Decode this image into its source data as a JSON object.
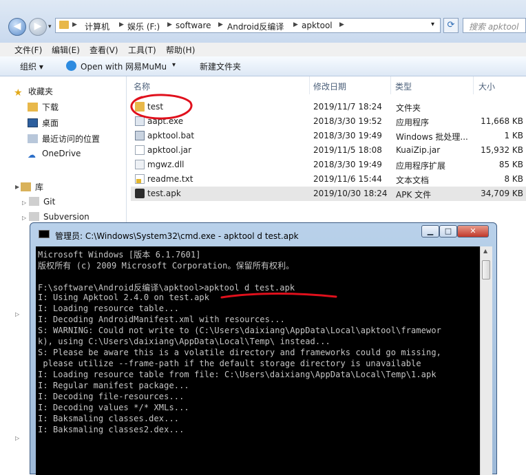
{
  "address": {
    "crumbs": [
      "计算机",
      "娱乐 (F:)",
      "software",
      "Android反编译",
      "apktool"
    ],
    "search_placeholder": "搜索 apktool"
  },
  "menu": [
    "文件(F)",
    "编辑(E)",
    "查看(V)",
    "工具(T)",
    "帮助(H)"
  ],
  "toolbar": {
    "organize": "组织 ▾",
    "open_with": "Open with 网易MuMu",
    "new_folder": "新建文件夹"
  },
  "nav": {
    "favorites": "收藏夹",
    "downloads": "下载",
    "desktop": "桌面",
    "recent": "最近访问的位置",
    "onedrive": "OneDrive",
    "libraries": "库",
    "git": "Git",
    "subversion": "Subversion"
  },
  "columns": {
    "name": "名称",
    "modified": "修改日期",
    "type": "类型",
    "size": "大小"
  },
  "files": [
    {
      "name": "test",
      "date": "2019/11/7 18:24",
      "type": "文件夹",
      "size": "",
      "icon": "folder-icon"
    },
    {
      "name": "aapt.exe",
      "date": "2018/3/30 19:52",
      "type": "应用程序",
      "size": "11,668 KB",
      "icon": "exe-icon"
    },
    {
      "name": "apktool.bat",
      "date": "2018/3/30 19:49",
      "type": "Windows 批处理...",
      "size": "1 KB",
      "icon": "bat-icon"
    },
    {
      "name": "apktool.jar",
      "date": "2019/11/5 18:08",
      "type": "KuaiZip.jar",
      "size": "15,932 KB",
      "icon": "file-icon"
    },
    {
      "name": "mgwz.dll",
      "date": "2018/3/30 19:49",
      "type": "应用程序扩展",
      "size": "85 KB",
      "icon": "dll-icon"
    },
    {
      "name": "readme.txt",
      "date": "2019/11/6 15:44",
      "type": "文本文档",
      "size": "8 KB",
      "icon": "txt-icon"
    },
    {
      "name": "test.apk",
      "date": "2019/10/30 18:24",
      "type": "APK 文件",
      "size": "34,709 KB",
      "icon": "apk-icon"
    }
  ],
  "cmd": {
    "title": "管理员: C:\\Windows\\System32\\cmd.exe - apktool  d test.apk",
    "lines": [
      "Microsoft Windows [版本 6.1.7601]",
      "版权所有 (c) 2009 Microsoft Corporation。保留所有权利。",
      "",
      "F:\\software\\Android反编译\\apktool>apktool d test.apk",
      "I: Using Apktool 2.4.0 on test.apk",
      "I: Loading resource table...",
      "I: Decoding AndroidManifest.xml with resources...",
      "S: WARNING: Could not write to (C:\\Users\\daixiang\\AppData\\Local\\apktool\\framewor",
      "k), using C:\\Users\\daixiang\\AppData\\Local\\Temp\\ instead...",
      "S: Please be aware this is a volatile directory and frameworks could go missing,",
      " please utilize --frame-path if the default storage directory is unavailable",
      "I: Loading resource table from file: C:\\Users\\daixiang\\AppData\\Local\\Temp\\1.apk",
      "I: Regular manifest package...",
      "I: Decoding file-resources...",
      "I: Decoding values */* XMLs...",
      "I: Baksmaling classes.dex...",
      "I: Baksmaling classes2.dex..."
    ]
  },
  "colors": {
    "annotation": "#e0101c",
    "console_bg": "#000000",
    "console_text": "#c6c6c6",
    "folder": "#e8b84a"
  }
}
